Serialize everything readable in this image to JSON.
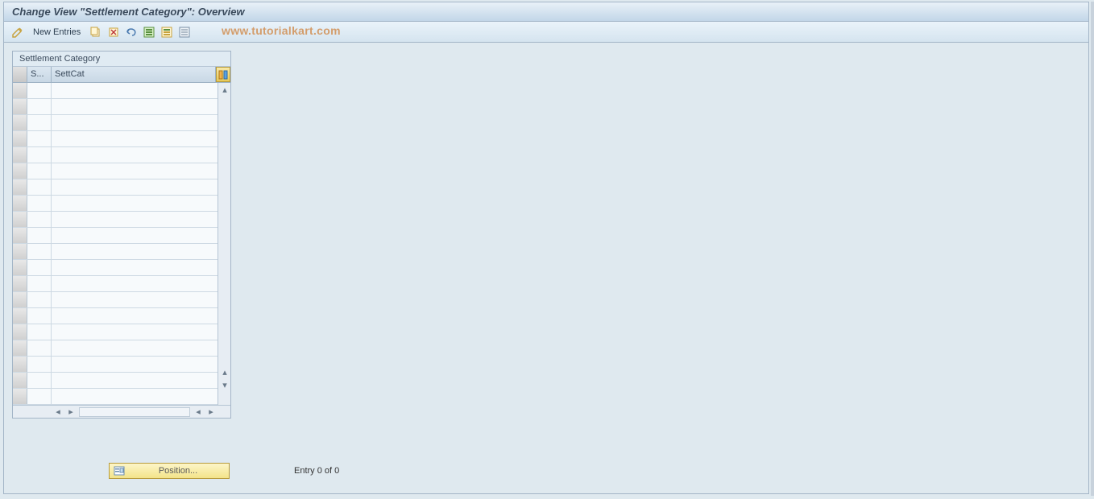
{
  "title": "Change View \"Settlement Category\": Overview",
  "toolbar": {
    "new_entries_label": "New Entries"
  },
  "watermark": "www.tutorialkart.com",
  "table": {
    "title": "Settlement Category",
    "col1": "S...",
    "col2": "SettCat",
    "row_count": 20
  },
  "footer": {
    "position_label": "Position...",
    "entry_text": "Entry 0 of 0"
  }
}
